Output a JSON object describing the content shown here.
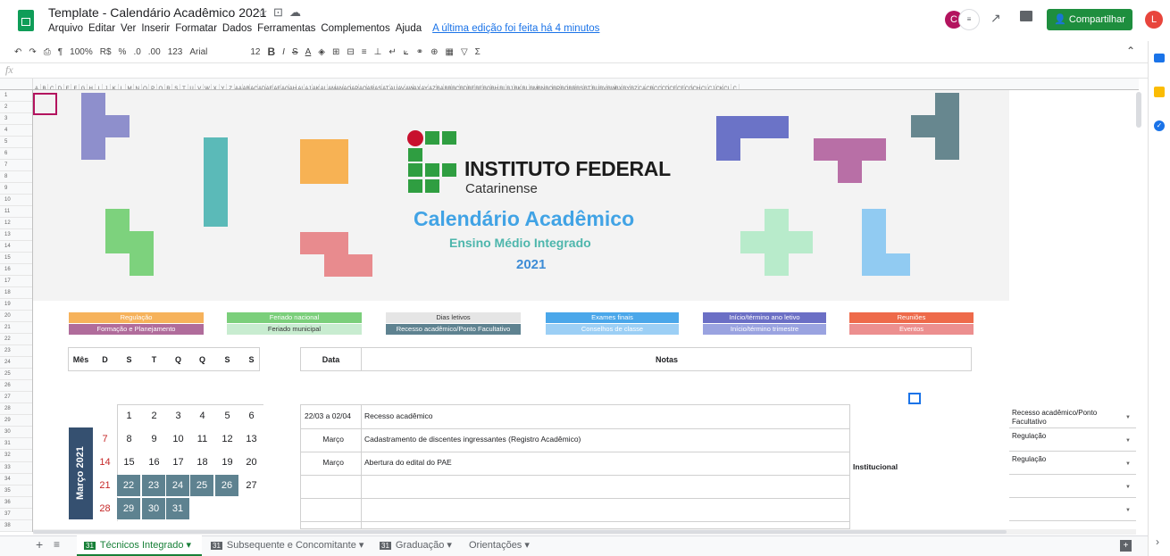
{
  "header": {
    "title": "Template - Calendário Acadêmico 2021",
    "menus": [
      "Arquivo",
      "Editar",
      "Ver",
      "Inserir",
      "Formatar",
      "Dados",
      "Ferramentas",
      "Complementos",
      "Ajuda"
    ],
    "last_edit": "A última edição foi feita há 4 minutos",
    "avatar_c": "C",
    "avatar_l": "L",
    "share_label": "Compartilhar"
  },
  "toolbar": {
    "zoom": "100%",
    "currency": "R$",
    "percent": "%",
    "dec_less": ".0",
    "dec_more": ".00",
    "format": "123",
    "font": "Arial",
    "size": "12",
    "bold": "B",
    "italic": "I",
    "strike": "S",
    "color": "A"
  },
  "formula": {
    "fx": "fx"
  },
  "columns": [
    "A",
    "B",
    "C",
    "D",
    "E",
    "F",
    "G",
    "H",
    "I",
    "J",
    "K",
    "L",
    "M",
    "N",
    "O",
    "P",
    "Q",
    "R",
    "S",
    "T",
    "U",
    "V",
    "W",
    "X",
    "Y",
    "Z",
    "AA",
    "AB",
    "AC",
    "AD",
    "AE",
    "AF",
    "AG",
    "AH",
    "AI",
    "AJ",
    "AK",
    "AL",
    "AM",
    "AN",
    "AO",
    "AP",
    "AQ",
    "AR",
    "AS",
    "AT",
    "AU",
    "AV",
    "AW",
    "AX",
    "AY",
    "AZ",
    "BA",
    "BB",
    "BC",
    "BD",
    "BE",
    "BF",
    "BG",
    "BH",
    "BI",
    "BJ",
    "BK",
    "BL",
    "BM",
    "BN",
    "BO",
    "BP",
    "BQ",
    "BR",
    "BS",
    "BT",
    "BU",
    "BV",
    "BW",
    "BX",
    "BY",
    "BZ",
    "CA",
    "CB",
    "CC",
    "CD",
    "CE",
    "CF",
    "CG",
    "CH",
    "CI",
    "CJ",
    "CK",
    "CL",
    "C"
  ],
  "rows": [
    "1",
    "2",
    "3",
    "4",
    "5",
    "6",
    "7",
    "8",
    "9",
    "10",
    "11",
    "12",
    "13",
    "14",
    "15",
    "16",
    "17",
    "18",
    "19",
    "20",
    "21",
    "22",
    "23",
    "24",
    "25",
    "26",
    "27",
    "28",
    "29",
    "30",
    "31",
    "32",
    "33",
    "34",
    "35",
    "36",
    "37",
    "38"
  ],
  "banner": {
    "org_title": "INSTITUTO FEDERAL",
    "org_sub": "Catarinense",
    "cal_title": "Calendário Acadêmico",
    "cal_sub": "Ensino Médio Integrado",
    "year": "2021"
  },
  "legend": [
    {
      "label": "Regulação",
      "color": "#f6b25b"
    },
    {
      "label": "Formação e Planejamento",
      "color": "#b06c9b"
    },
    {
      "label": "Feriado nacional",
      "color": "#7bcf7b"
    },
    {
      "label": "Feriado municipal",
      "color": "#c8ecd0"
    },
    {
      "label": "Dias letivos",
      "color": "#e5e5e5"
    },
    {
      "label": "Recesso acadêmico/Ponto Facultativo",
      "color": "#5e8290"
    },
    {
      "label": "Exames finais",
      "color": "#4aa7ea"
    },
    {
      "label": "Conselhos de classe",
      "color": "#9ccff5"
    },
    {
      "label": "Início/término ano letivo",
      "color": "#6b6fc5"
    },
    {
      "label": "Início/término trimestre",
      "color": "#9aa3e0"
    },
    {
      "label": "Reuniões",
      "color": "#ee6a4a"
    },
    {
      "label": "Eventos",
      "color": "#ec8f8f"
    }
  ],
  "cal_header": [
    "Mês",
    "D",
    "S",
    "T",
    "Q",
    "Q",
    "S",
    "S"
  ],
  "notes_header": {
    "date": "Data",
    "notes": "Notas"
  },
  "month": "Março 2021",
  "weeks": [
    [
      "",
      "",
      "1",
      "2",
      "3",
      "4",
      "5",
      "6"
    ],
    [
      "",
      "7",
      "8",
      "9",
      "10",
      "11",
      "12",
      "13"
    ],
    [
      "",
      "14",
      "15",
      "16",
      "17",
      "18",
      "19",
      "20"
    ],
    [
      "",
      "21",
      "22",
      "23",
      "24",
      "25",
      "26",
      "27"
    ],
    [
      "",
      "28",
      "29",
      "30",
      "31",
      "",
      "",
      ""
    ]
  ],
  "notes": [
    {
      "date": "22/03 a 02/04",
      "text": "Recesso acadêmico"
    },
    {
      "date": "Março",
      "text": "Cadastramento de discentes ingressantes (Registro Acadêmico)"
    },
    {
      "date": "Março",
      "text": "Abertura do edital do PAE"
    },
    {
      "date": "",
      "text": ""
    },
    {
      "date": "",
      "text": ""
    }
  ],
  "category": "Institucional",
  "dropdowns": [
    "Recesso acadêmico/Ponto Facultativo",
    "Regulação",
    "Regulação",
    "",
    ""
  ],
  "tabs": [
    "Técnicos Integrado",
    "Subsequente e Concomitante",
    "Graduação",
    "Orientações"
  ]
}
